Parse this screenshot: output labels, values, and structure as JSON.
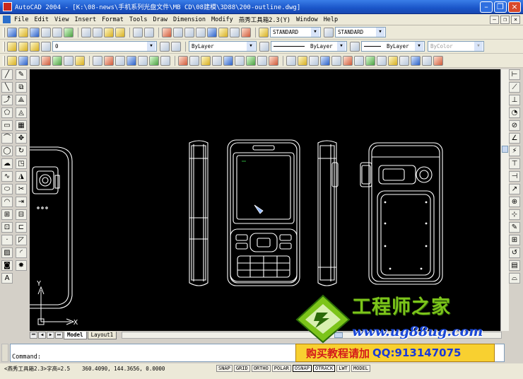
{
  "window": {
    "title": "AutoCAD 2004 - [K:\\08-news\\手机系列光盘文件\\MB CD\\08建模\\3D88\\200-outline.dwg]"
  },
  "menu": [
    "File",
    "Edit",
    "View",
    "Insert",
    "Format",
    "Tools",
    "Draw",
    "Dimension",
    "Modify",
    "燕秀工具箱2.3(Y)",
    "Window",
    "Help"
  ],
  "styles": {
    "text_style": "STANDARD",
    "dim_style": "STANDARD"
  },
  "layers": {
    "current": "0"
  },
  "properties": {
    "color": "ByLayer",
    "linetype": "ByLayer",
    "lineweight": "ByLayer",
    "plotstyle": "ByColor"
  },
  "layout_tabs": [
    "Model",
    "Layout1"
  ],
  "ucs": {
    "y": "Y",
    "x": "X"
  },
  "command": {
    "prompt": "Command:"
  },
  "status": {
    "progress": "<燕秀工具箱2.3>字高=2.5",
    "coords": "360.4090, 144.3656, 0.0000",
    "toggles": [
      "SNAP",
      "GRID",
      "ORTHO",
      "POLAR",
      "OSNAP",
      "OTRACK",
      "LWT",
      "MODEL"
    ]
  },
  "watermark": {
    "site_name": "工程师之家",
    "url": "www.ug88ug.com",
    "buy_text": "购买教程请加",
    "qq": "QQ:913147075"
  },
  "colors": {
    "title": "#1a55c8",
    "canvas": "#000000",
    "watermark_green": "#7cc41a",
    "watermark_blue": "#1a48d8",
    "banner": "#f8d030"
  }
}
